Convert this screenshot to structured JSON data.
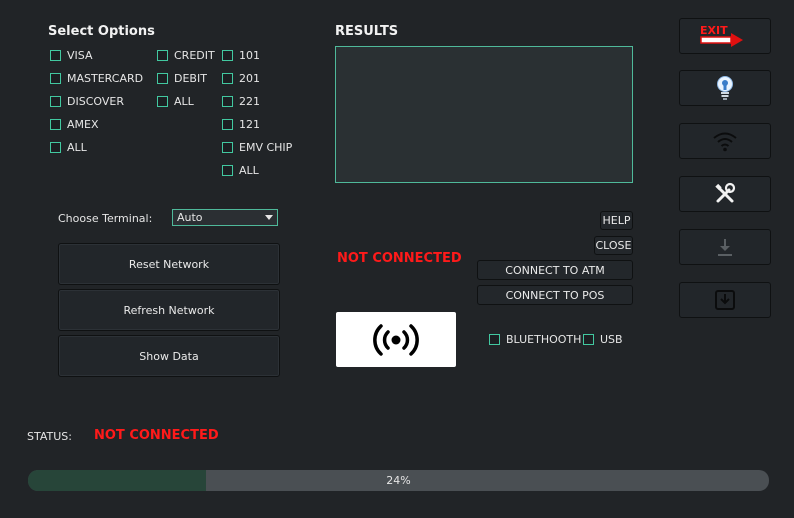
{
  "select_options": {
    "title": "Select Options",
    "cards": [
      "VISA",
      "MASTERCARD",
      "DISCOVER",
      "AMEX",
      "ALL"
    ],
    "types": [
      "CREDIT",
      "DEBIT",
      "ALL"
    ],
    "codes": [
      "101",
      "201",
      "221",
      "121",
      "EMV CHIP",
      "ALL"
    ]
  },
  "results": {
    "title": "RESULTS"
  },
  "terminal": {
    "label": "Choose Terminal:",
    "selected": "Auto"
  },
  "buttons": {
    "reset_network": "Reset Network",
    "refresh_network": "Refresh Network",
    "show_data": "Show Data",
    "help": "HELP",
    "close": "CLOSE",
    "connect_atm": "CONNECT TO ATM",
    "connect_pos": "CONNECT TO POS"
  },
  "connection": {
    "status_text": "NOT CONNECTED",
    "bluetooth": "BLUETHOOTH",
    "usb": "USB"
  },
  "status": {
    "label": "STATUS:",
    "value": "NOT CONNECTED"
  },
  "progress": {
    "percent": 24,
    "label": "24%"
  },
  "sidebar": {
    "exit_label": "EXIT",
    "icons": [
      "exit-icon",
      "lightbulb-icon",
      "wifi-icon",
      "tools-icon",
      "download-icon",
      "import-icon"
    ]
  },
  "colors": {
    "background": "#212427",
    "accent": "#42c8a0",
    "alert": "#ff1a1a",
    "progress_fill": "#274539"
  }
}
